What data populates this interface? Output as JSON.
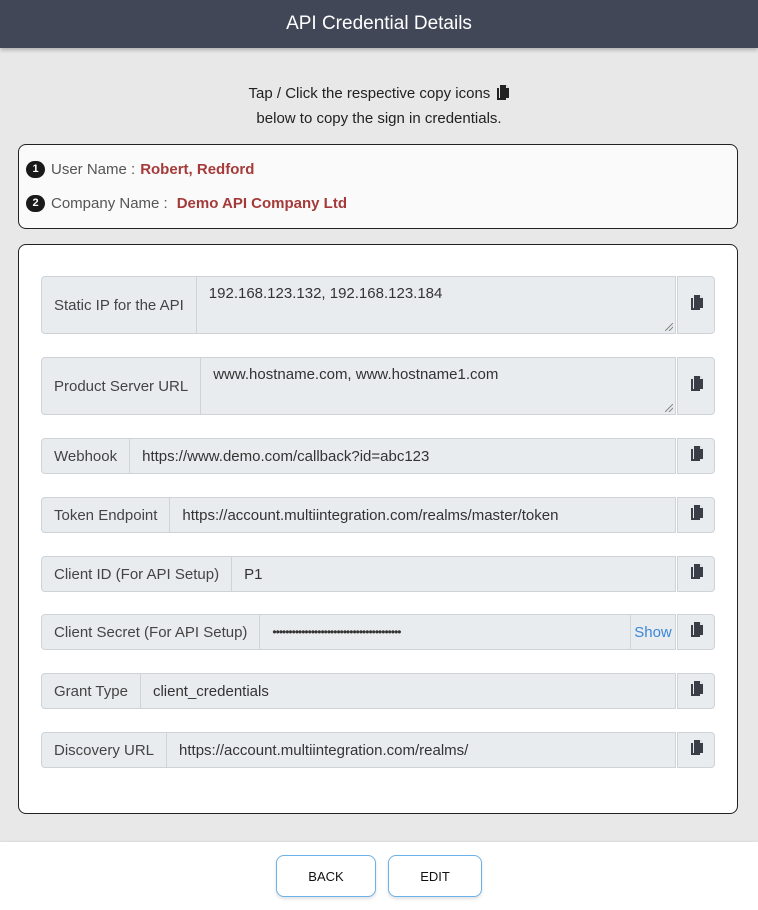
{
  "header": {
    "title": "API Credential Details"
  },
  "intro": {
    "line1": "Tap / Click the respective copy icons",
    "line2": "below to copy the sign in credentials.",
    "icon": "copy-icon"
  },
  "user": {
    "rows": [
      {
        "badge": "1",
        "label": "User Name :",
        "value": "Robert, Redford"
      },
      {
        "badge": "2",
        "label": "Company Name :",
        "value": "Demo API Company Ltd"
      }
    ]
  },
  "credentials": {
    "fields": [
      {
        "label": "Static IP for the API",
        "value": "192.168.123.132, 192.168.123.184",
        "type": "textarea",
        "copy_icon": "copy-icon"
      },
      {
        "label": "Product Server URL",
        "value": "www.hostname.com, www.hostname1.com",
        "type": "textarea",
        "copy_icon": "copy-icon"
      },
      {
        "label": "Webhook",
        "value": "https://www.demo.com/callback?id=abc123",
        "type": "input",
        "copy_icon": "copy-icon"
      },
      {
        "label": "Token Endpoint",
        "value": "https://account.multiintegration.com/realms/master/token",
        "type": "input",
        "copy_icon": "copy-icon"
      },
      {
        "label": "Client ID (For API Setup)",
        "value": "P1",
        "type": "input",
        "copy_icon": "copy-icon"
      },
      {
        "label": "Client Secret (For API Setup)",
        "value": "••••••••••••••••••••••••••••••••••••••••",
        "type": "password",
        "show_label": "Show",
        "copy_icon": "copy-icon"
      },
      {
        "label": "Grant Type",
        "value": "client_credentials",
        "type": "input",
        "copy_icon": "copy-icon"
      },
      {
        "label": "Discovery URL",
        "value": "https://account.multiintegration.com/realms/",
        "type": "input",
        "copy_icon": "copy-icon"
      }
    ]
  },
  "footer": {
    "back_label": "BACK",
    "edit_label": "EDIT"
  },
  "colors": {
    "header_bg": "#414756",
    "highlight_value": "#a53a3a",
    "show_link": "#3a86d8",
    "button_border": "#6ab2ea"
  }
}
